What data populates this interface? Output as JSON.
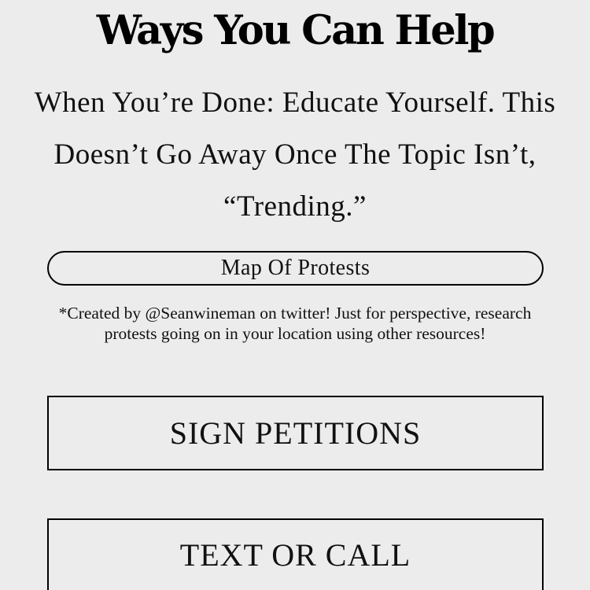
{
  "header": {
    "title": "Ways You Can Help"
  },
  "intro": {
    "text": "When You’re Done: Educate Yourself. This Doesn’t Go Away Once The Topic Isn’t, “Trending.”"
  },
  "map_link": {
    "label": "Map Of Protests"
  },
  "note": {
    "text": "*Created by @Seanwineman on twitter! Just for perspective, research protests going on in your location using other resources!"
  },
  "actions": [
    {
      "label": "SIGN PETITIONS"
    },
    {
      "label": "TEXT OR CALL"
    }
  ]
}
